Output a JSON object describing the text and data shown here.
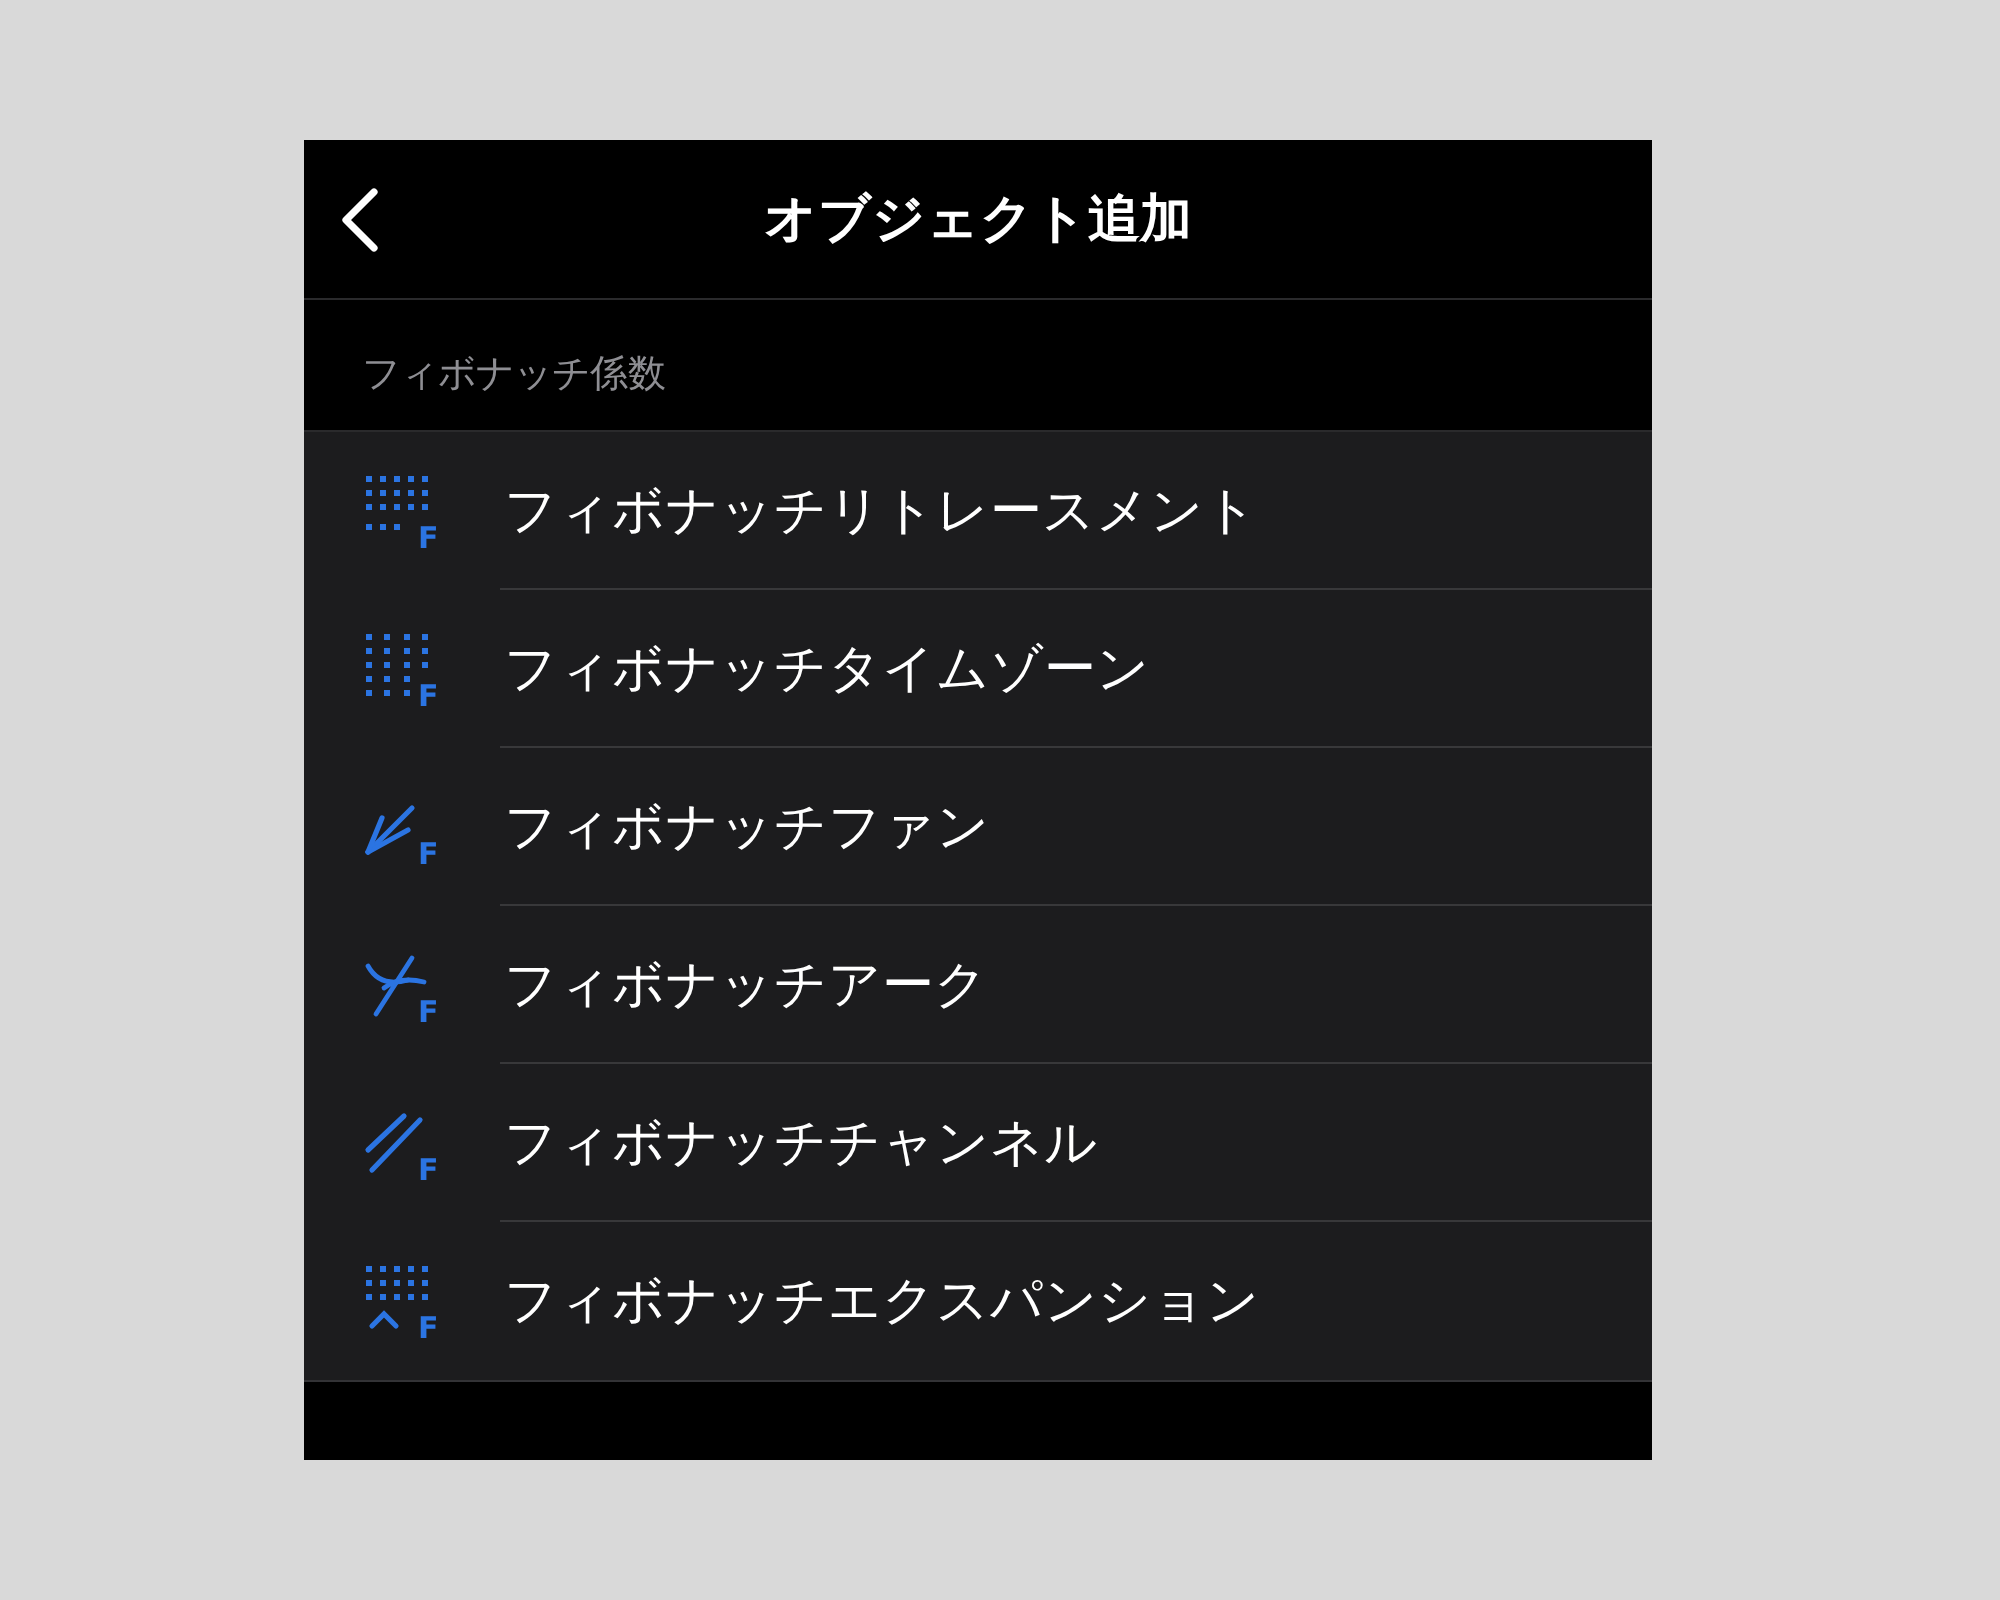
{
  "header": {
    "title": "オブジェクト追加"
  },
  "section": {
    "title": "フィボナッチ係数",
    "items": [
      {
        "kind": "retracement",
        "label": "フィボナッチリトレースメント",
        "icon_letter": "F"
      },
      {
        "kind": "timezone",
        "label": "フィボナッチタイムゾーン",
        "icon_letter": "F"
      },
      {
        "kind": "fan",
        "label": "フィボナッチファン",
        "icon_letter": "F"
      },
      {
        "kind": "arc",
        "label": "フィボナッチアーク",
        "icon_letter": "F"
      },
      {
        "kind": "channel",
        "label": "フィボナッチチャンネル",
        "icon_letter": "F"
      },
      {
        "kind": "expansion",
        "label": "フィボナッチエクスパンション",
        "icon_letter": "F"
      }
    ]
  }
}
